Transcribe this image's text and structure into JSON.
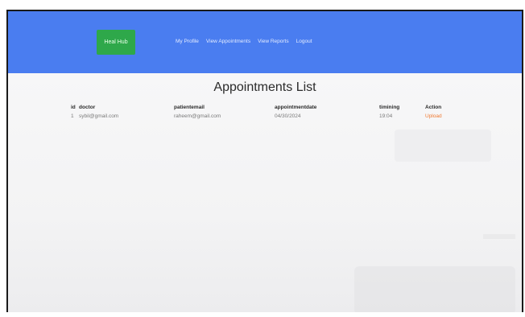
{
  "navbar": {
    "brand": "Heal Hub",
    "links": [
      "My Profile",
      "View Appointments",
      "View Reports",
      "Logout"
    ]
  },
  "page": {
    "title": "Appointments List"
  },
  "table": {
    "headers": [
      "id",
      "doctor",
      "patientemail",
      "appointmentdate",
      "timining",
      "Action"
    ],
    "rows": [
      {
        "id": "1",
        "doctor": "sybil@gmail.com",
        "patientemail": "raheem@gmail.com",
        "appointmentdate": "04/30/2024",
        "timining": "19:04",
        "action": "Upload"
      }
    ]
  },
  "colors": {
    "navbar": "#4a7df0",
    "brand_button": "#2ea84a",
    "action_link": "#f07a32"
  }
}
